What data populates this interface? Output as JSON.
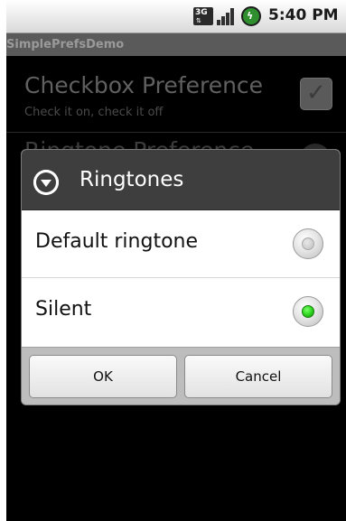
{
  "status_bar": {
    "network_icon": "3g-data-icon",
    "network_label": "3G",
    "signal_icon": "signal-bars-icon",
    "battery_icon": "battery-charging-icon",
    "time": "5:40 PM"
  },
  "app": {
    "title": "SimplePrefsDemo"
  },
  "prefs": {
    "checkbox": {
      "title": "Checkbox Preference",
      "summary": "Check it on, check it off",
      "checked": true
    },
    "ringtone": {
      "title": "Ringtone Preference"
    }
  },
  "dialog": {
    "icon": "dropdown-arrow-icon",
    "title": "Ringtones",
    "options": [
      {
        "label": "Default ringtone",
        "selected": false
      },
      {
        "label": "Silent",
        "selected": true
      }
    ],
    "ok_label": "OK",
    "cancel_label": "Cancel"
  },
  "colors": {
    "radio_selected": "#2fd81f",
    "dialog_header": "#3e3e3e",
    "footer": "#bdbdbd"
  }
}
